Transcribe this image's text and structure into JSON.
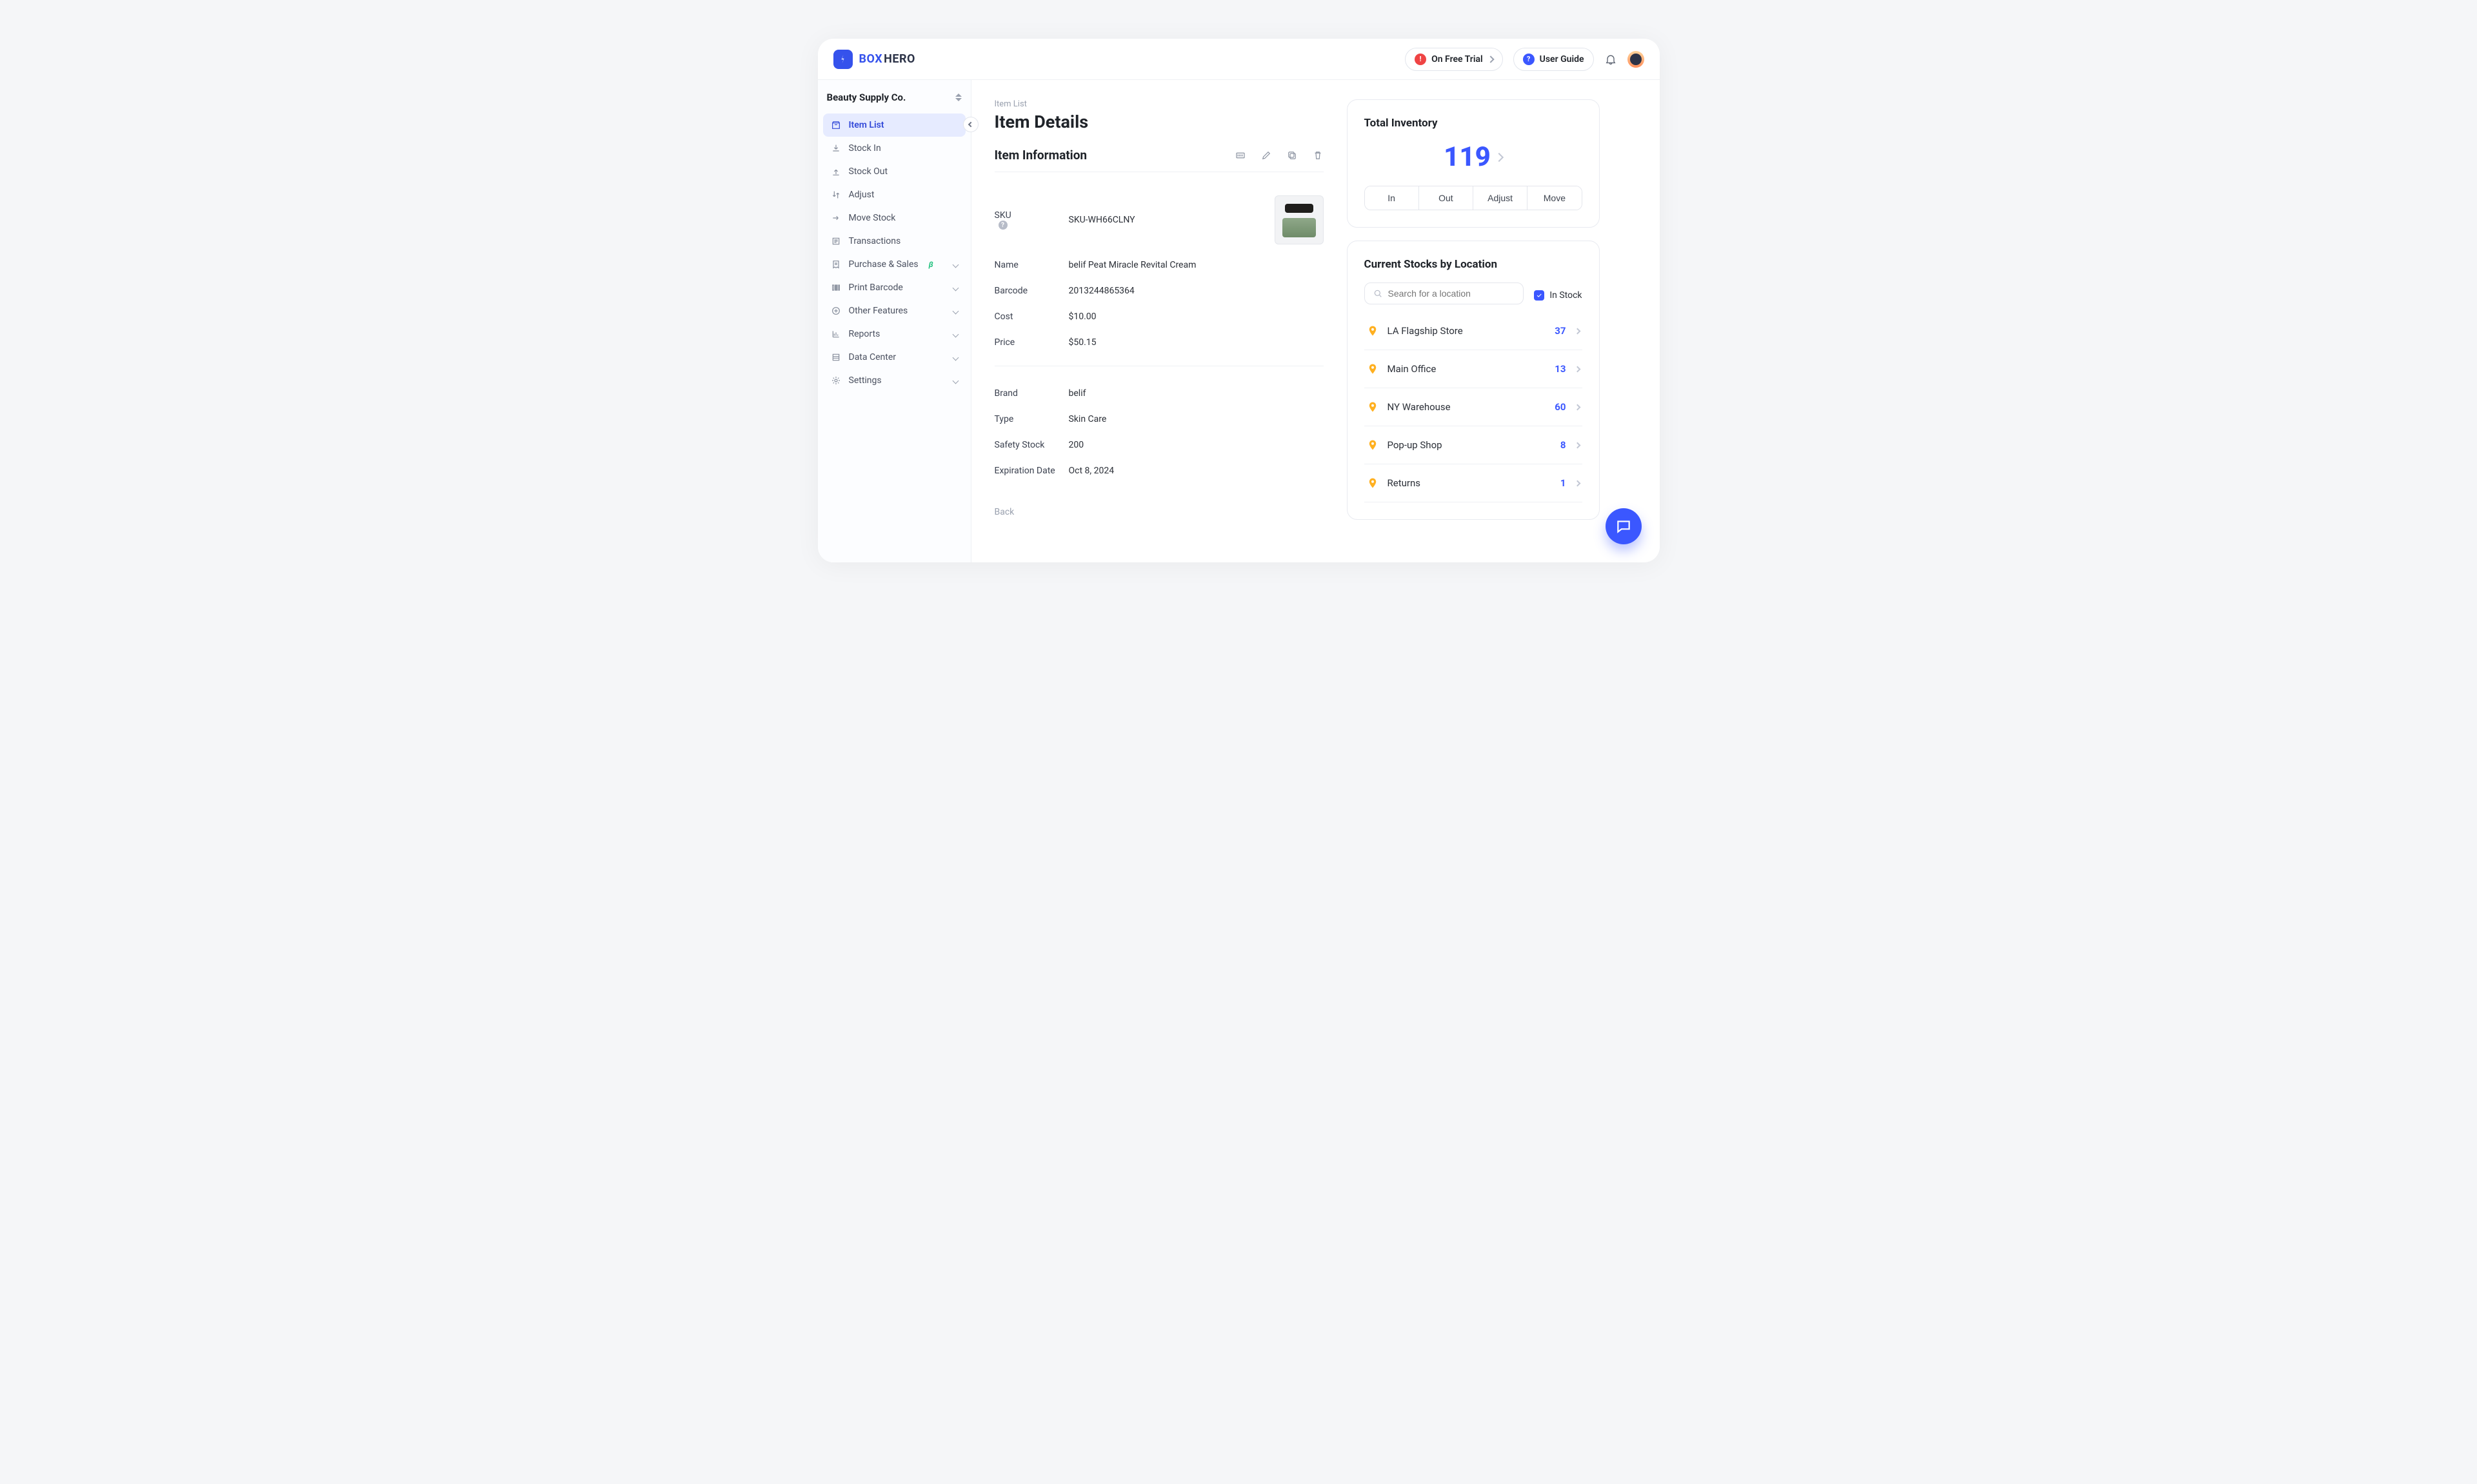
{
  "brand": {
    "box": "BOX",
    "hero": "HERO"
  },
  "topbar": {
    "trial": "On Free Trial",
    "guide": "User Guide"
  },
  "workspace": {
    "name": "Beauty Supply Co."
  },
  "nav": {
    "item_list": "Item List",
    "stock_in": "Stock In",
    "stock_out": "Stock Out",
    "adjust": "Adjust",
    "move_stock": "Move Stock",
    "transactions": "Transactions",
    "purchase_sales": "Purchase & Sales",
    "print_barcode": "Print Barcode",
    "other_features": "Other Features",
    "reports": "Reports",
    "data_center": "Data Center",
    "settings": "Settings",
    "beta": "β"
  },
  "page": {
    "crumb": "Item List",
    "title": "Item Details",
    "section": "Item Information",
    "back": "Back"
  },
  "labels": {
    "sku": "SKU",
    "name": "Name",
    "barcode": "Barcode",
    "cost": "Cost",
    "price": "Price",
    "brand": "Brand",
    "type": "Type",
    "safety": "Safety Stock",
    "exp": "Expiration Date"
  },
  "item": {
    "sku": "SKU-WH66CLNY",
    "name": "belif Peat Miracle Revital Cream",
    "barcode": "2013244865364",
    "cost": "$10.00",
    "price": "$50.15",
    "brand": "belif",
    "type": "Skin Care",
    "safety": "200",
    "exp": "Oct 8, 2024"
  },
  "inventory": {
    "title": "Total Inventory",
    "qty": "119",
    "in": "In",
    "out": "Out",
    "adjust": "Adjust",
    "move": "Move"
  },
  "stocks": {
    "title": "Current Stocks by Location",
    "search_placeholder": "Search for a location",
    "instock": "In Stock",
    "locations": [
      {
        "name": "LA Flagship Store",
        "qty": "37"
      },
      {
        "name": "Main Office",
        "qty": "13"
      },
      {
        "name": "NY Warehouse",
        "qty": "60"
      },
      {
        "name": "Pop-up Shop",
        "qty": "8"
      },
      {
        "name": "Returns",
        "qty": "1"
      }
    ]
  }
}
